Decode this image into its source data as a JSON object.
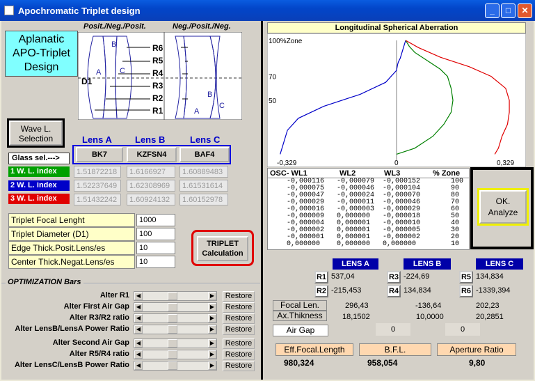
{
  "window": {
    "title": "Apochromatic Triplet design"
  },
  "design_label": [
    "Aplanatic",
    "APO-Triplet",
    "Design"
  ],
  "diagram": {
    "left_caption": "Posit./Neg./Posit.",
    "right_caption": "Neg./Posit./Neg.",
    "surfaces": [
      "R6",
      "R5",
      "R4",
      "R3",
      "R2",
      "R1"
    ],
    "diameter_label": "D1",
    "lens_letters": [
      "A",
      "B",
      "C"
    ]
  },
  "wave_button": "Wave L. Selection",
  "lens_headers": [
    "Lens A",
    "Lens B",
    "Lens C"
  ],
  "glass_sel_label": "Glass sel.--->",
  "glasses": [
    "BK7",
    "KZFSN4",
    "BAF4"
  ],
  "wl_rows": [
    {
      "label": "1 W. L. index",
      "color": "#00a000",
      "values": [
        "1.51872218",
        "1.6166927",
        "1.60889483"
      ]
    },
    {
      "label": "2 W. L. index",
      "color": "#0000c8",
      "values": [
        "1.52237649",
        "1.62308969",
        "1.61531614"
      ]
    },
    {
      "label": "3 W. L. index",
      "color": "#e00000",
      "values": [
        "1.51432242",
        "1.60924132",
        "1.60152978"
      ]
    }
  ],
  "params": [
    {
      "label": "Triplet Focal Lenght",
      "value": "1000"
    },
    {
      "label": "Triplet Diameter  (D1)",
      "value": "100"
    },
    {
      "label": "Edge Thick.Posit.Lens/es",
      "value": "10"
    },
    {
      "label": "Center Thick.Negat.Lens/es",
      "value": "10"
    }
  ],
  "triplet_button": "TRIPLET Calculation",
  "opt_header": "OPTIMIZATION Bars",
  "opt_bars": [
    {
      "label": "Alter  R1",
      "restore": "Restore"
    },
    {
      "label": "Alter  First Air Gap",
      "restore": "Restore"
    },
    {
      "label": "Alter R3/R2  ratio",
      "restore": "Restore"
    },
    {
      "label": "Alter LensB/LensA Power Ratio",
      "restore": "Restore"
    },
    {
      "label": "Alter Second Air Gap",
      "restore": "Restore"
    },
    {
      "label": "Alter R5/R4 ratio",
      "restore": "Restore"
    },
    {
      "label": "Alter LensC/LensB Power Ratio",
      "restore": "Restore"
    }
  ],
  "chart_title": "Longitudinal  Spherical  Aberration",
  "chart_data": {
    "type": "line",
    "title": "Longitudinal  Spherical  Aberration",
    "y_tick_labels": [
      "100%Zone",
      "70",
      "50"
    ],
    "x_tick_labels": [
      "-0,329",
      "0",
      "0,329"
    ],
    "xlim": [
      -0.329,
      0.329
    ],
    "series": [
      {
        "color": "#0000c8",
        "points": [
          [
            0.025,
            100
          ],
          [
            0.02,
            95
          ],
          [
            0.015,
            90
          ],
          [
            0.01,
            85
          ],
          [
            0.005,
            82
          ],
          [
            0.003,
            80
          ],
          [
            0.0,
            75
          ],
          [
            -0.03,
            65
          ],
          [
            -0.1,
            55
          ],
          [
            -0.2,
            45
          ],
          [
            -0.27,
            35
          ],
          [
            -0.3,
            25
          ],
          [
            -0.31,
            15
          ],
          [
            -0.32,
            5
          ]
        ]
      },
      {
        "color": "#008000",
        "points": [
          [
            0.025,
            100
          ],
          [
            0.035,
            95
          ],
          [
            0.05,
            90
          ],
          [
            0.08,
            84
          ],
          [
            0.12,
            76
          ],
          [
            0.14,
            70
          ],
          [
            0.15,
            60
          ],
          [
            0.155,
            50
          ],
          [
            0.15,
            40
          ],
          [
            0.13,
            30
          ],
          [
            0.1,
            20
          ],
          [
            0.05,
            10
          ],
          [
            0.0,
            5
          ]
        ]
      },
      {
        "color": "#e00000",
        "points": [
          [
            0.025,
            100
          ],
          [
            0.06,
            94
          ],
          [
            0.12,
            86
          ],
          [
            0.2,
            78
          ],
          [
            0.26,
            70
          ],
          [
            0.3,
            60
          ],
          [
            0.31,
            50
          ],
          [
            0.31,
            40
          ],
          [
            0.305,
            30
          ],
          [
            0.29,
            20
          ],
          [
            0.28,
            10
          ],
          [
            0.27,
            5
          ]
        ]
      }
    ]
  },
  "osc_table": {
    "headers": [
      "OSC-  WL1",
      "WL2",
      "WL3",
      "% Zone"
    ],
    "rows": [
      [
        "-0,000116",
        "-0,000079",
        "-0,000152",
        "100"
      ],
      [
        "-0,000075",
        "-0,000046",
        "-0,000104",
        "90"
      ],
      [
        "-0,000047",
        "-0,000024",
        "-0,000070",
        "80"
      ],
      [
        "-0,000029",
        "-0,000011",
        "-0,000046",
        "70"
      ],
      [
        "-0,000016",
        "-0,000003",
        "-0,000029",
        "60"
      ],
      [
        "-0,000009",
        "0,000000",
        "-0,000018",
        "50"
      ],
      [
        "-0,000004",
        "0,000001",
        "-0,000010",
        "40"
      ],
      [
        "-0,000002",
        "0,000001",
        "-0,000005",
        "30"
      ],
      [
        "-0,000001",
        "0,000001",
        "-0,000002",
        "20"
      ],
      [
        "0,000000",
        "0,000000",
        "0,000000",
        "10"
      ]
    ]
  },
  "ok_button": "OK. Analyze",
  "results": {
    "lens_headers": [
      "LENS A",
      "LENS B",
      "LENS C"
    ],
    "radii": [
      {
        "name": "R1",
        "value": "537,04"
      },
      {
        "name": "R2",
        "value": "-215,453"
      },
      {
        "name": "R3",
        "value": "-224,69"
      },
      {
        "name": "R4",
        "value": "134,834"
      },
      {
        "name": "R5",
        "value": "134,834"
      },
      {
        "name": "R6",
        "value": "-1339,394"
      }
    ],
    "focal_label": "Focal Len.",
    "focal_values": [
      "296,43",
      "-136,64",
      "202,23"
    ],
    "thick_label": "Ax.Thikness",
    "thick_values": [
      "18,1502",
      "10,0000",
      "20,2851"
    ],
    "airgap_label": "Air Gap",
    "airgap_values": [
      "0",
      "0"
    ],
    "summary_labels": [
      "Eff.Focal.Length",
      "B.F.L.",
      "Aperture Ratio"
    ],
    "summary_values": [
      "980,324",
      "958,054",
      "9,80"
    ]
  }
}
